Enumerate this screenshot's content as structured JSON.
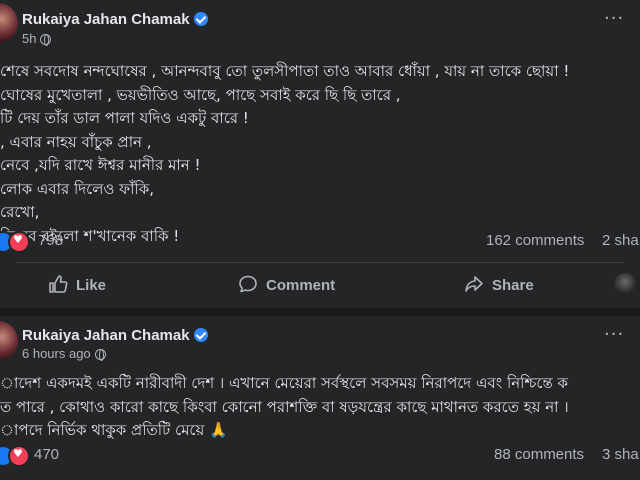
{
  "post1": {
    "author": "Rukaiya Jahan Chamak",
    "time": "5h",
    "lines": [
      "শেষে সবদোষ  নন্দঘোষের , আনন্দবাবু তো তুলসীপাতা তাও আবার ধোঁয়া , যায় না তাকে ছোয়া !",
      "ঘোষের মুখেতালা , ভয়ভীতিও আছে, পাছে সবাই করে ছি ছি তারে ,",
      "টি দেয় তাঁর ডাল পালা যদিও একটু বারে !",
      ", এবার নাহয় বাঁচুক প্রান ,",
      "নেবে ,যদি রাখে ঈশ্বর মানীর মান !",
      "লোক এবার দিলেও ফাঁকি,",
      "রেখো,",
      "হিসেব রইলো শ'খানেক বাকি !"
    ],
    "reactions": "798",
    "comments": "162 comments",
    "shares": "2 sha",
    "actions": {
      "like": "Like",
      "comment": "Comment",
      "share": "Share"
    }
  },
  "post2": {
    "author": "Rukaiya Jahan Chamak",
    "time": "6 hours ago",
    "lines": [
      "াদেশ একদমই একটি নারীবাদী দেশ । এখানে মেয়েরা সর্বস্থলে সবসময় নিরাপদে এবং নিশ্চিন্তে ক",
      "ত পারে , কোথাও কারো কাছে কিংবা কোনো পরাশক্তি বা ষড়যন্ত্রের কাছে মাথানত করতে হয় না ।",
      "াপদে নির্ভিক থাকুক প্রতিটি মেয়ে 🙏"
    ],
    "reactions": "470",
    "comments": "88 comments",
    "shares": "3 sha"
  },
  "icons": [
    "verified-badge-icon",
    "globe-icon",
    "more-options-icon",
    "like-reaction-icon",
    "love-reaction-icon",
    "like-icon",
    "comment-icon",
    "share-icon",
    "profile-icon"
  ],
  "colors": {
    "background": "#18191a",
    "card": "#242526",
    "text": "#e4e6eb",
    "secondary": "#b0b3b8",
    "verified": "#2d88ff",
    "like": "#1877f2",
    "love": "#f33e58"
  }
}
